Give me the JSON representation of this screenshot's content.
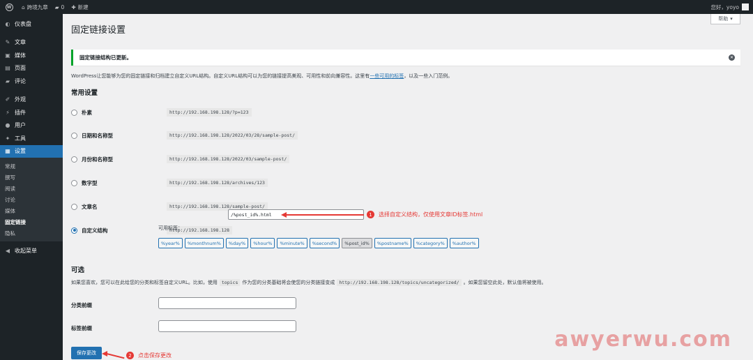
{
  "adminbar": {
    "site_name": "跨境九章",
    "comments_count": "0",
    "new_label": "新建",
    "greeting": "您好，yoyo"
  },
  "sidebar": {
    "items": [
      {
        "icon": "dashboard-icon",
        "glyph": "◐",
        "label": "仪表盘"
      },
      {
        "icon": "pin-icon",
        "glyph": "✎",
        "label": "文章"
      },
      {
        "icon": "media-icon",
        "glyph": "▣",
        "label": "媒体"
      },
      {
        "icon": "page-icon",
        "glyph": "▤",
        "label": "页面"
      },
      {
        "icon": "comment-icon",
        "glyph": "▰",
        "label": "评论"
      },
      {
        "icon": "appearance-icon",
        "glyph": "✐",
        "label": "外观"
      },
      {
        "icon": "plugin-icon",
        "glyph": "⚡",
        "label": "插件"
      },
      {
        "icon": "user-icon",
        "glyph": "●",
        "label": "用户"
      },
      {
        "icon": "tools-icon",
        "glyph": "✦",
        "label": "工具"
      },
      {
        "icon": "settings-icon",
        "glyph": "▦",
        "label": "设置"
      }
    ],
    "submenu": [
      "常规",
      "撰写",
      "阅读",
      "讨论",
      "媒体",
      "固定链接",
      "隐私"
    ],
    "collapse_label": "收起菜单"
  },
  "main": {
    "help_label": "帮助",
    "title": "固定链接设置",
    "notice": "固定链接结构已更新。",
    "intro_before": "WordPress让您能够为您的固定链接和归档建立自定义URL结构。自定义URL结构可以为您的链接提高美观、可用性和前向兼容性。这里有",
    "intro_link": "一些可用的标签",
    "intro_after": "，以及一些入门范例。",
    "common_heading": "常用设置",
    "options": [
      {
        "label": "朴素",
        "example": "http://192.168.198.128/?p=123"
      },
      {
        "label": "日期和名称型",
        "example": "http://192.168.198.128/2022/03/28/sample-post/"
      },
      {
        "label": "月份和名称型",
        "example": "http://192.168.198.128/2022/03/sample-post/"
      },
      {
        "label": "数字型",
        "example": "http://192.168.198.128/archives/123"
      },
      {
        "label": "文章名",
        "example": "http://192.168.198.128/sample-post/"
      },
      {
        "label": "自定义结构",
        "example": "http://192.168.198.128"
      }
    ],
    "custom_value": "/%post_id%.html",
    "available_tags_label": "可用标签：",
    "tags": [
      "%year%",
      "%monthnum%",
      "%day%",
      "%hour%",
      "%minute%",
      "%second%",
      "%post_id%",
      "%postname%",
      "%category%",
      "%author%"
    ],
    "optional_heading": "可选",
    "optional_desc_1": "如果您喜欢，您可以在此给您的分类和标签自定义URL。比如，使用",
    "optional_code_1": "topics",
    "optional_desc_2": "作为您的分类基础将会使您的分类链接变成",
    "optional_code_2": "http://192.168.198.128/topics/uncategorized/",
    "optional_desc_3": "。如果您留空此处，默认值将被使用。",
    "category_base_label": "分类前缀",
    "tag_base_label": "标签前缀",
    "save_label": "保存更改"
  },
  "annotations": {
    "a1_num": "1",
    "a1_text": "选择自定义结构，仅使用文章ID标签.html",
    "a2_num": "2",
    "a2_text": "点击保存更改",
    "color": "#e53935"
  },
  "watermark": "awyerwu.com",
  "colors": {
    "accent": "#2271b1",
    "sidebar": "#1d2327",
    "success": "#00a32a"
  }
}
